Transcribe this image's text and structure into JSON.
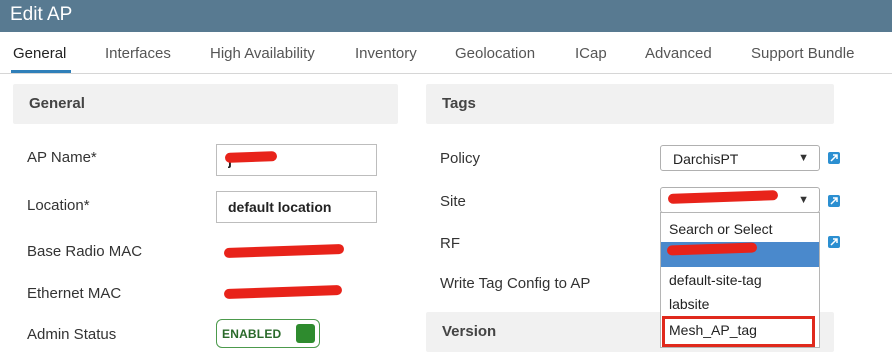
{
  "window": {
    "title": "Edit AP"
  },
  "tabs": [
    {
      "label": "General",
      "active": true
    },
    {
      "label": "Interfaces"
    },
    {
      "label": "High Availability"
    },
    {
      "label": "Inventory"
    },
    {
      "label": "Geolocation"
    },
    {
      "label": "ICap"
    },
    {
      "label": "Advanced"
    },
    {
      "label": "Support Bundle"
    }
  ],
  "general": {
    "header": "General",
    "ap_name": {
      "label": "AP Name*",
      "value": "j"
    },
    "location": {
      "label": "Location*",
      "value": "default location"
    },
    "base_radio_mac": {
      "label": "Base Radio MAC"
    },
    "ethernet_mac": {
      "label": "Ethernet MAC"
    },
    "admin_status": {
      "label": "Admin Status",
      "value": "ENABLED"
    }
  },
  "tags": {
    "header": "Tags",
    "policy": {
      "label": "Policy",
      "value": "DarchisPT"
    },
    "site": {
      "label": "Site",
      "value": ""
    },
    "rf": {
      "label": "RF"
    },
    "write_tag": {
      "label": "Write Tag Config to AP"
    }
  },
  "site_dropdown": {
    "options": [
      "Search or Select",
      "",
      "default-site-tag",
      "labsite",
      "Mesh_AP_tag"
    ],
    "highlighted_index": 1
  },
  "version": {
    "header": "Version"
  },
  "colors": {
    "titlebar": "#587a91",
    "accent": "#2f7fb9",
    "enabled_green": "#2e8b2e",
    "redaction": "#e8231a"
  }
}
